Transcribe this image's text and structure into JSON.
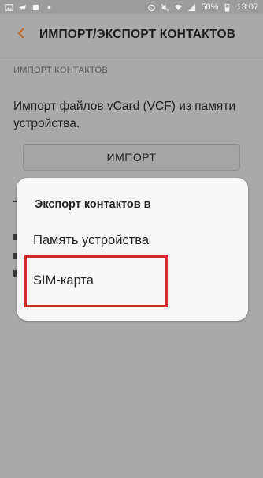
{
  "status_bar": {
    "battery": "50%",
    "time": "13:07"
  },
  "header": {
    "title": "ИМПОРТ/ЭКСПОРТ КОНТАКТОВ"
  },
  "import_section": {
    "header": "ИМПОРТ КОНТАКТОВ",
    "description": "Импорт файлов vCard (VCF) из памяти устройства.",
    "button_label": "ИМПОРТ"
  },
  "dialog": {
    "title": "Экспорт контактов в",
    "options": [
      {
        "label": "Память устройства"
      },
      {
        "label": "SIM-карта"
      }
    ]
  },
  "colors": {
    "highlight": "#d02a2a",
    "back_arrow": "#d2691e"
  }
}
